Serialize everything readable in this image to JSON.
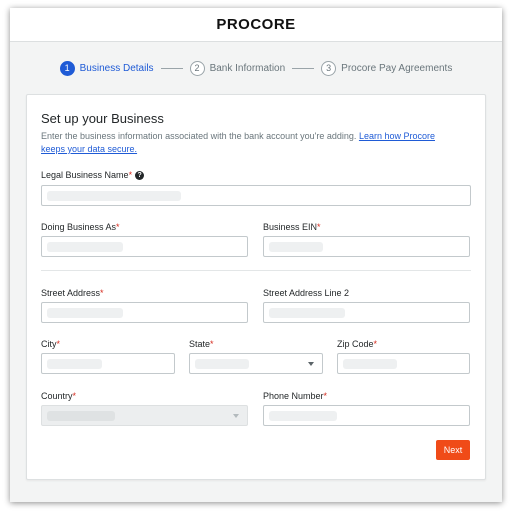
{
  "header": {
    "logo_text": "PROCORE"
  },
  "stepper": [
    {
      "number": "1",
      "label": "Business Details",
      "active": true
    },
    {
      "number": "2",
      "label": "Bank Information",
      "active": false
    },
    {
      "number": "3",
      "label": "Procore Pay Agreements",
      "active": false
    }
  ],
  "form": {
    "title": "Set up your Business",
    "description": "Enter the business information associated with the bank account you're adding.",
    "learn_link": "Learn how Procore keeps your data secure.",
    "required_marker": "*",
    "help_glyph": "?",
    "fields": {
      "legal_name": {
        "label": "Legal Business Name",
        "value": ""
      },
      "dba": {
        "label": "Doing Business As",
        "value": ""
      },
      "ein": {
        "label": "Business EIN",
        "value": ""
      },
      "street": {
        "label": "Street Address",
        "value": ""
      },
      "street2": {
        "label": "Street Address Line 2",
        "value": ""
      },
      "city": {
        "label": "City",
        "value": ""
      },
      "state": {
        "label": "State",
        "value": ""
      },
      "zip": {
        "label": "Zip Code",
        "value": ""
      },
      "country": {
        "label": "Country",
        "value": "",
        "disabled": true
      },
      "phone": {
        "label": "Phone Number",
        "value": ""
      }
    },
    "next_label": "Next"
  },
  "colors": {
    "primary_blue": "#1f5bd6",
    "accent_orange": "#f04b18",
    "required_red": "#d62b1f"
  }
}
